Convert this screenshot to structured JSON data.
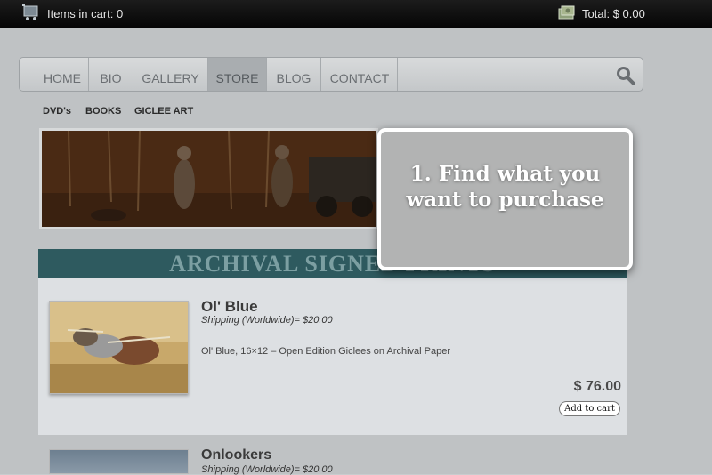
{
  "topbar": {
    "cart_label": "Items in cart: 0",
    "total_label": "Total: $ 0.00",
    "cart_icon": "cart-icon",
    "money_icon": "money-icon"
  },
  "nav": {
    "items": [
      {
        "label": "HOME"
      },
      {
        "label": "BIO"
      },
      {
        "label": "GALLERY"
      },
      {
        "label": "STORE"
      },
      {
        "label": "BLOG"
      },
      {
        "label": "CONTACT"
      }
    ],
    "active": "STORE",
    "search_icon": "search-icon"
  },
  "subnav": [
    "DVD's",
    "BOOKS",
    "GICLEE ART"
  ],
  "section": {
    "title": "ARCHIVAL SIGNED PRINTS"
  },
  "products": [
    {
      "title": "Ol' Blue",
      "shipping": "Shipping (Worldwide)= $20.00",
      "description": "Ol' Blue, 16×12 – Open Edition Giclees on Archival Paper",
      "price": "$ 76.00",
      "button": "Add to cart"
    },
    {
      "title": "Onlookers",
      "shipping": "Shipping (Worldwide)= $20.00"
    }
  ],
  "callout": {
    "text": "1. Find what you want to purchase"
  },
  "colors": {
    "section_bg": "#2e5a5f",
    "callout_bg": "#b2b3b3",
    "topbar_bg": "#0a0a0a"
  }
}
